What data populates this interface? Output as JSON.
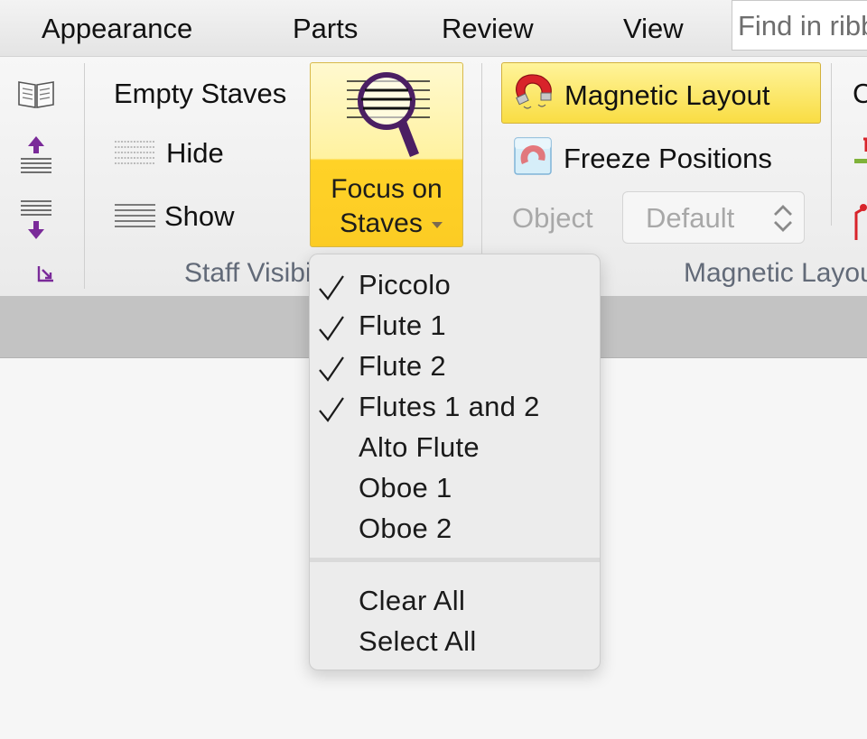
{
  "tabs": [
    "Appearance",
    "Parts",
    "Review",
    "View"
  ],
  "search": {
    "placeholder": "Find in ribbon"
  },
  "staff_group": {
    "empty_staves_label": "Empty Staves",
    "hide_label": "Hide",
    "show_label": "Show",
    "focus_line1": "Focus on",
    "focus_line2": "Staves",
    "group_label": "Staff Visibility"
  },
  "magnetic_group": {
    "magnetic_layout_label": "Magnetic Layout",
    "freeze_positions_label": "Freeze Positions",
    "object_label": "Object",
    "object_select_value": "Default",
    "group_label": "Magnetic Layout",
    "next_group_initial": "C"
  },
  "menu": {
    "items": [
      {
        "label": "Piccolo",
        "checked": true
      },
      {
        "label": "Flute 1",
        "checked": true
      },
      {
        "label": "Flute 2",
        "checked": true
      },
      {
        "label": "Flutes 1 and 2",
        "checked": true
      },
      {
        "label": "Alto Flute",
        "checked": false
      },
      {
        "label": "Oboe 1",
        "checked": false
      },
      {
        "label": "Oboe 2",
        "checked": false
      }
    ],
    "actions": [
      "Clear All",
      "Select All"
    ]
  },
  "colors": {
    "accent_yellow": "#fccc24",
    "group_label": "#626a78",
    "arrow_purple": "#7a2a99",
    "disabled_text": "#a8a8a8"
  },
  "icons": [
    "book-icon",
    "move-staff-up-icon",
    "move-staff-down-icon",
    "dialog-launcher-icon",
    "hide-staves-icon",
    "show-staves-icon",
    "magnifier-staves-icon",
    "dropdown-arrow-icon",
    "magnet-icon",
    "freeze-icon",
    "stepper-icon",
    "checkmark-icon"
  ]
}
